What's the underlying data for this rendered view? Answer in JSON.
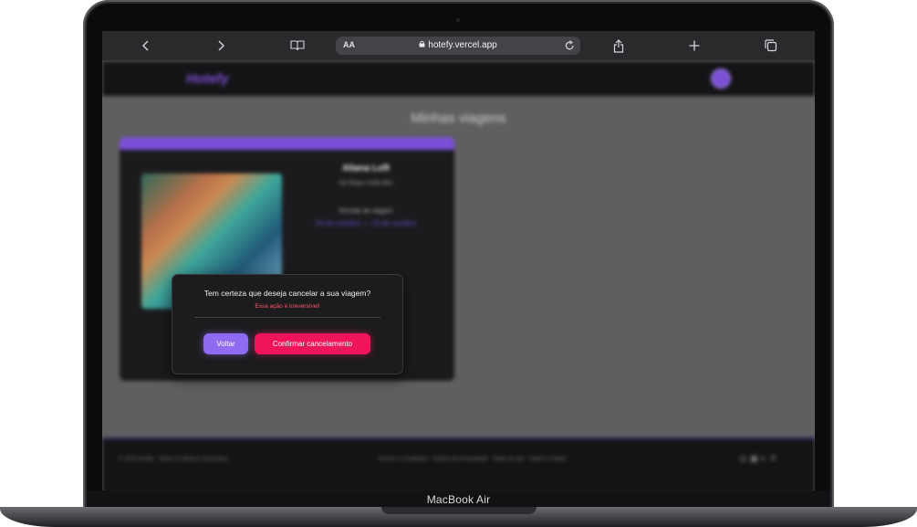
{
  "device": {
    "model_label": "MacBook Air"
  },
  "browser": {
    "url": "hotefy.vercel.app",
    "text_size_label": "AA",
    "icons": [
      "back-icon",
      "forward-icon",
      "bookmarks-icon",
      "lock-icon",
      "reload-icon",
      "share-icon",
      "new-tab-icon",
      "tabs-icon"
    ]
  },
  "site": {
    "logo": "Hotefy",
    "page_title": "Minhas viagens"
  },
  "trip_card": {
    "hotel_name": "Aliana Loft",
    "hotel_location": "Sal Ótayyu Cidão Blos",
    "period_label": "Período de viagem",
    "period_dates": "16 de outubro — 19 de outubro"
  },
  "modal": {
    "question": "Tem certeza que deseja cancelar a sua viagem?",
    "warning": "Essa ação é irreversível!",
    "back_label": "Voltar",
    "confirm_label": "Confirmar cancelamento"
  },
  "footer": {
    "copyright": "© 2025 Hotefy · Todos os direitos reservados",
    "links": "Termos e Condições · Política de Privacidade · Mapa do site · Sobre o Hotefy"
  },
  "colors": {
    "accent_purple": "#8e6bf0",
    "danger_pink": "#f0155a",
    "warning_red": "#ff5a6a"
  }
}
